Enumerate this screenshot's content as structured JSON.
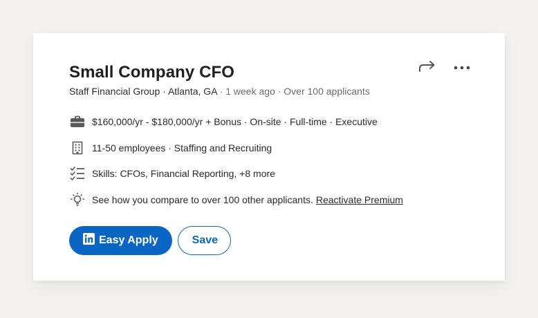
{
  "job": {
    "title": "Small Company CFO",
    "company": "Staff Financial Group",
    "location": "Atlanta, GA",
    "posted": "1 week ago",
    "applicants": "Over 100 applicants",
    "separator": " · "
  },
  "facts": [
    {
      "icon": "briefcase-icon",
      "text": "$160,000/yr - $180,000/yr + Bonus · On-site · Full-time · Executive"
    },
    {
      "icon": "building-icon",
      "text": "11-50 employees · Staffing and Recruiting"
    },
    {
      "icon": "checklist-icon",
      "text": "Skills: CFOs, Financial Reporting, +8 more"
    },
    {
      "icon": "lightbulb-icon",
      "text": "See how you compare to over 100 other applicants.",
      "link": "Reactivate Premium"
    }
  ],
  "actions": {
    "easy_apply_label": "Easy Apply",
    "save_label": "Save",
    "share_icon": "share-icon",
    "more_icon": "more-icon"
  },
  "colors": {
    "brand": "#0a66c2",
    "background": "#f3f2f0",
    "card": "#ffffff",
    "text": "#1f1f1f",
    "muted": "#6b6b6b"
  }
}
